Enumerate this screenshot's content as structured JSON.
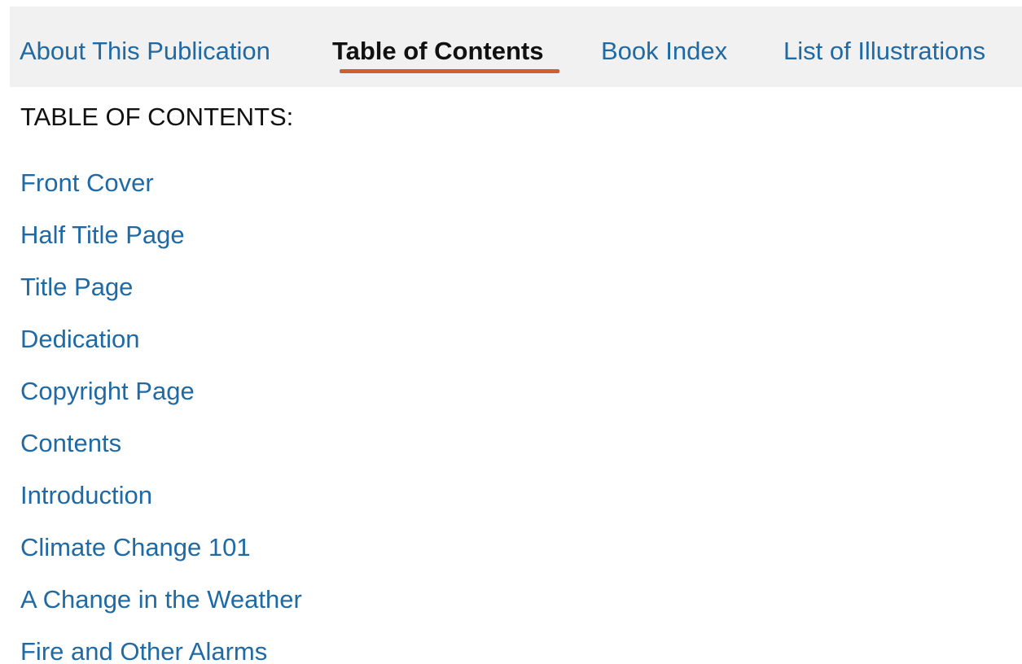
{
  "tabs": [
    {
      "label": "About This Publication",
      "active": false
    },
    {
      "label": "Table of Contents",
      "active": true
    },
    {
      "label": "Book Index",
      "active": false
    },
    {
      "label": "List of Illustrations",
      "active": false
    }
  ],
  "toc": {
    "heading": "TABLE OF CONTENTS:",
    "items": [
      "Front Cover",
      "Half Title Page",
      "Title Page",
      "Dedication",
      "Copyright Page",
      "Contents",
      "Introduction",
      "Climate Change 101",
      "A Change in the Weather",
      "Fire and Other Alarms"
    ]
  },
  "colors": {
    "link": "#1f6aa5",
    "active_text": "#111111",
    "tab_bar_background": "#f1f1f1",
    "active_underline": "#d0602a"
  }
}
